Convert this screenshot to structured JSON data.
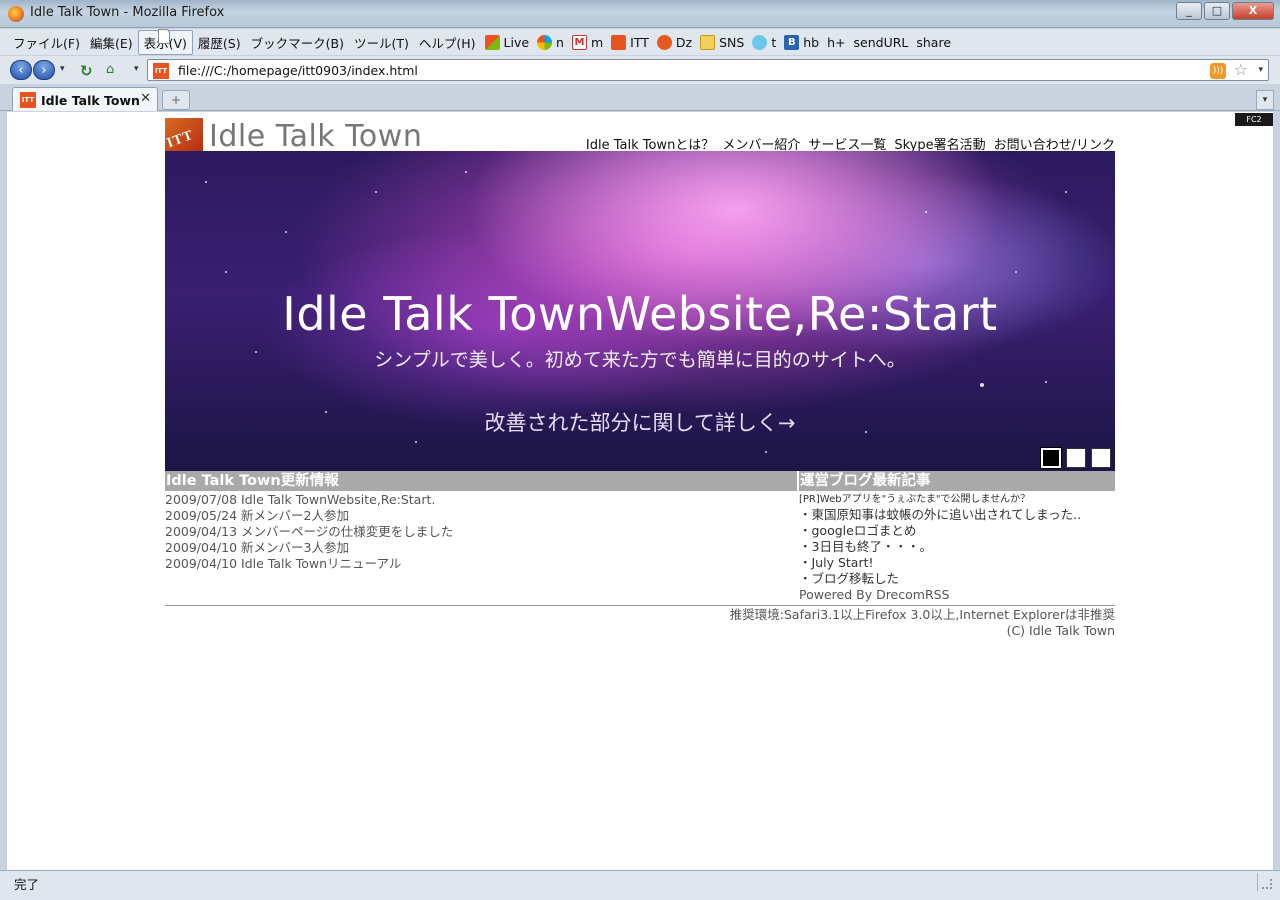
{
  "window": {
    "title": "Idle Talk Town - Mozilla Firefox",
    "controls": [
      "_",
      "□",
      "X"
    ]
  },
  "menubar": {
    "items": [
      "ファイル(F)",
      "編集(E)",
      "表示(V)",
      "履歴(S)",
      "ブックマーク(B)",
      "ツール(T)",
      "ヘルプ(H)"
    ],
    "bookmarks": [
      {
        "label": "Live",
        "icon": "windows-live-icon"
      },
      {
        "label": "n",
        "icon": "n-icon"
      },
      {
        "label": "m",
        "icon": "gmail-icon"
      },
      {
        "label": "ITT",
        "icon": "itt-icon"
      },
      {
        "label": "Dz",
        "icon": "dz-icon"
      },
      {
        "label": "SNS",
        "icon": "folder-icon"
      },
      {
        "label": "t",
        "icon": "twitter-icon"
      },
      {
        "label": "hb",
        "icon": "hatena-icon"
      },
      {
        "label": "h+",
        "icon": "page-icon"
      },
      {
        "label": "sendURL",
        "icon": "page-icon"
      },
      {
        "label": "share",
        "icon": "page-icon"
      }
    ]
  },
  "navbar": {
    "url": "file:///C:/homepage/itt0903/index.html"
  },
  "tabs": [
    {
      "label": "Idle Talk Town"
    }
  ],
  "page": {
    "logo_text": "Idle Talk Town",
    "logo_mark": "ITT",
    "fc2_badge": "FC2",
    "nav": [
      "Idle Talk Townとは？",
      "メンバー紹介",
      "サービス一覧",
      "Skype署名活動",
      "お問い合わせ/リンク"
    ],
    "hero": {
      "headline": "Idle Talk TownWebsite,Re:Start",
      "subline": "シンプルで美しく。初めて来た方でも簡単に目的のサイトへ。",
      "cta": "改善された部分に関して詳しく→",
      "slide_count": 3,
      "active_slide": 1
    },
    "updates": {
      "heading": "Idle Talk Town更新情報",
      "items": [
        "2009/07/08 Idle Talk TownWebsite,Re:Start.",
        "2009/05/24 新メンバー2人参加",
        "2009/04/13 メンバーページの仕様変更をしました",
        "2009/04/10 新メンバー3人参加",
        "2009/04/10 Idle Talk Townリニューアル"
      ]
    },
    "blog": {
      "heading": "運営ブログ最新記事",
      "pr": "[PR]Webアプリを\"うぇぶたま\"で公開しませんか？",
      "items": [
        "・東国原知事は蚊帳の外に追い出されてしまった..",
        "・googleロゴまとめ",
        "・3日目も終了・・・。",
        "・July Start!",
        "・ブログ移転した"
      ],
      "powered": "Powered By DrecomRSS"
    },
    "footer": {
      "env": "推奨環境:Safari3.1以上Firefox 3.0以上,Internet Explorerは非推奨",
      "copyright": "(C) Idle Talk Town"
    }
  },
  "status": {
    "text": "完了"
  }
}
